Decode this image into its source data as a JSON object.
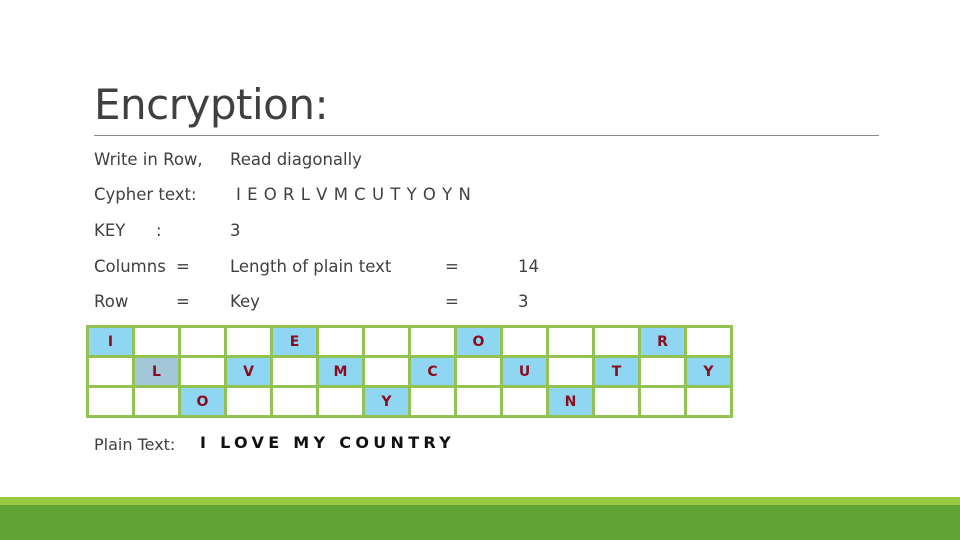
{
  "slide": {
    "title": "Encryption:",
    "method": {
      "label": "Write in Row,",
      "value": "Read diagonally"
    },
    "cypher": {
      "label": "Cypher text:",
      "value": "I E O R L V M C U T Y O Y N"
    },
    "key": {
      "label": "KEY",
      "sep": ":",
      "value": "3"
    },
    "columns": {
      "label": "Columns",
      "eq1": "=",
      "desc": "Length of plain text",
      "eq2": "=",
      "value": "14"
    },
    "rows": {
      "label": "Row",
      "eq1": "=",
      "desc": "Key",
      "eq2": "=",
      "value": "3"
    },
    "grid": [
      [
        "I",
        "",
        "",
        "",
        "E",
        "",
        "",
        "",
        "O",
        "",
        "",
        "",
        "R",
        ""
      ],
      [
        "",
        "L",
        "",
        "V",
        "",
        "M",
        "",
        "C",
        "",
        "U",
        "",
        "T",
        "",
        "Y"
      ],
      [
        "",
        "",
        "O",
        "",
        "",
        "",
        "Y",
        "",
        "",
        "",
        "N",
        "",
        "",
        ""
      ]
    ],
    "plain": {
      "label": "Plain Text:",
      "value": "I LOVE MY COUNTRY"
    },
    "colors": {
      "cell_highlight": "#8fd6f2",
      "grid_border": "#92c252",
      "letter": "#8b0a1e",
      "footer_light": "#99c843",
      "footer_dark": "#62a338"
    }
  }
}
